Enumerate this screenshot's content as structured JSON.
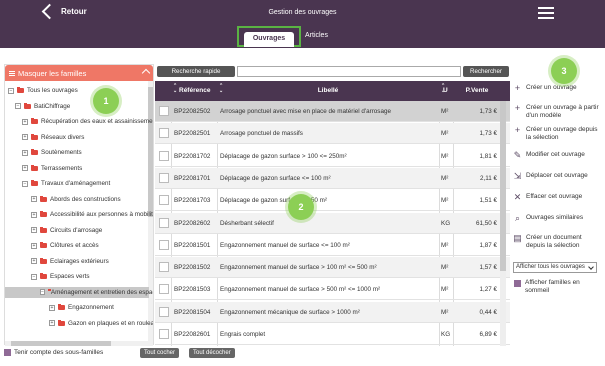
{
  "header": {
    "back_label": "Retour",
    "title": "Gestion des ouvrages",
    "tabs": [
      {
        "label": "Ouvrages",
        "active": true
      },
      {
        "label": "Articles",
        "active": false
      }
    ],
    "bg_color": "#4a3550",
    "highlight_color": "#5ab343"
  },
  "left_panel": {
    "header_label": "Masquer les familles",
    "header_color": "#ef7766",
    "tree": [
      {
        "label": "Tous les ouvrages",
        "level": 0,
        "expander": "−"
      },
      {
        "label": "BatiChiffrage",
        "level": 1,
        "expander": "−"
      },
      {
        "label": "Récupération des eaux et assainissement",
        "level": 2,
        "expander": "+"
      },
      {
        "label": "Réseaux divers",
        "level": 2,
        "expander": "+"
      },
      {
        "label": "Soutènements",
        "level": 2,
        "expander": "+"
      },
      {
        "label": "Terrassements",
        "level": 2,
        "expander": "+"
      },
      {
        "label": "Travaux d'aménagement",
        "level": 2,
        "expander": "−"
      },
      {
        "label": "Abords des constructions",
        "level": 3,
        "expander": "+"
      },
      {
        "label": "Accessibilité aux personnes à mobilité réduite",
        "level": 3,
        "expander": "+"
      },
      {
        "label": "Circuits d'arrosage",
        "level": 3,
        "expander": "+"
      },
      {
        "label": "Clôtures et accès",
        "level": 3,
        "expander": "+"
      },
      {
        "label": "Eclairages extérieurs",
        "level": 3,
        "expander": "+"
      },
      {
        "label": "Espaces verts",
        "level": 3,
        "expander": "−"
      },
      {
        "label": "Aménagement et entretien des espaces verts",
        "level": 4,
        "expander": "−",
        "selected": true
      },
      {
        "label": "Engazonnement",
        "level": 5,
        "expander": "+"
      },
      {
        "label": "Gazon en plaques et en rouleaux",
        "level": 5,
        "expander": "+"
      }
    ],
    "subfamily_label": "Tenir compte des sous-familles",
    "check_all_label": "Tout cocher",
    "uncheck_all_label": "Tout décocher"
  },
  "search": {
    "quick_label": "Recherche rapide",
    "value": "",
    "button_label": "Rechercher"
  },
  "table": {
    "columns": [
      "Référence",
      "Libellé",
      "U",
      "P.Vente"
    ],
    "rows": [
      {
        "ref": "BP22082502",
        "label": "Arrosage ponctuel avec mise en place de matériel d'arrosage",
        "unit": "M²",
        "price": "1,73 €"
      },
      {
        "ref": "BP22082501",
        "label": "Arrosage ponctuel de massifs",
        "unit": "M²",
        "price": "1,73 €"
      },
      {
        "ref": "BP22081702",
        "label": "Déplacage de gazon surface > 100 <= 250m²",
        "unit": "M²",
        "price": "1,81 €"
      },
      {
        "ref": "BP22081701",
        "label": "Déplacage de gazon surface <= 100 m²",
        "unit": "M²",
        "price": "2,11 €"
      },
      {
        "ref": "BP22081703",
        "label": "Déplacage de gazon surface > 250 m²",
        "unit": "M²",
        "price": "1,51 €"
      },
      {
        "ref": "BP22082602",
        "label": "Désherbant sélectif",
        "unit": "KG",
        "price": "61,50 €"
      },
      {
        "ref": "BP22081501",
        "label": "Engazonnement manuel de surface <= 100 m²",
        "unit": "M²",
        "price": "1,87 €"
      },
      {
        "ref": "BP22081502",
        "label": "Engazonnement manuel de surface > 100 m² <= 500 m²",
        "unit": "M²",
        "price": "1,57 €"
      },
      {
        "ref": "BP22081503",
        "label": "Engazonnement manuel de surface > 500 m² <= 1000 m²",
        "unit": "M²",
        "price": "1,27 €"
      },
      {
        "ref": "BP22081504",
        "label": "Engazonnement mécanique de surface > 1000 m²",
        "unit": "M²",
        "price": "0,44 €"
      },
      {
        "ref": "BP22082601",
        "label": "Engrais complet",
        "unit": "KG",
        "price": "6,89 €"
      }
    ]
  },
  "actions": [
    {
      "label": "Créer un ouvrage",
      "icon": "plus-icon"
    },
    {
      "label": "Créer un ouvrage à partir d'un modèle",
      "icon": "plus-icon"
    },
    {
      "label": "Créer un ouvrage depuis la sélection",
      "icon": "plus-icon"
    },
    {
      "label": "Modifier cet ouvrage",
      "icon": "pencil-icon"
    },
    {
      "label": "Déplacer cet ouvrage",
      "icon": "move-icon"
    },
    {
      "label": "Effacer cet ouvrage",
      "icon": "x-icon"
    },
    {
      "label": "Ouvrages similaires",
      "icon": "search-icon"
    },
    {
      "label": "Créer un document depuis la sélection",
      "icon": "document-icon"
    }
  ],
  "filter_select": {
    "value": "Afficher tous les ouvrages"
  },
  "sleep_families_label": "Afficher familles en sommeil",
  "badges": [
    "1",
    "2",
    "3"
  ]
}
